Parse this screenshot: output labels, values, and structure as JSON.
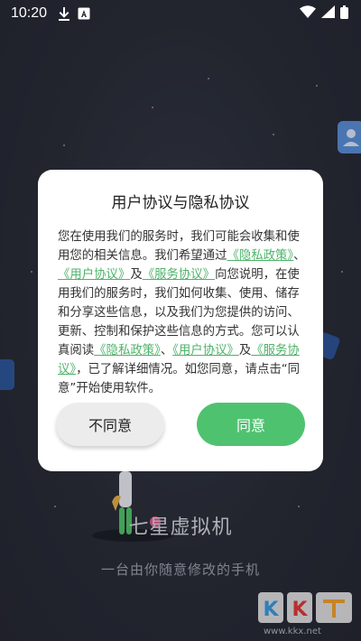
{
  "status_bar": {
    "time": "10:20",
    "left_icons": [
      "download-icon",
      "a-box-icon"
    ],
    "right_icons": [
      "wifi-icon",
      "cellular-signal-icon",
      "battery-icon"
    ]
  },
  "background": {
    "app_name": "七星虚拟机",
    "slogan": "一台由你随意修改的手机",
    "watermark_url": "www.kkx.net",
    "colors": {
      "background": "#2b2e3a",
      "accent": "#4fc270"
    }
  },
  "dialog": {
    "title": "用户协议与隐私协议",
    "body": {
      "t1": "您在使用我们的服务时，我们可能会收集和使用您的相关信息。我们希望通过",
      "privacy_link": "《隐私政策》",
      "sep1": "、",
      "user_link": "《用户协议》",
      "and1": "及",
      "service_link": "《服务协议》",
      "t2": "向您说明，在使用我们的服务时，我们如何收集、使用、储存和分享这些信息，以及我们为您提供的访问、更新、控制和保护这些信息的方式。您可以认真阅读",
      "privacy_link2": "《隐私政策》",
      "sep2": "、",
      "user_link2": "《用户协议》",
      "and2": "及",
      "service_link2": "《服务协议》",
      "t3": "，已了解详细情况。如您同意，请点击“同意”开始使用软件。"
    },
    "disagree_label": "不同意",
    "agree_label": "同意"
  }
}
